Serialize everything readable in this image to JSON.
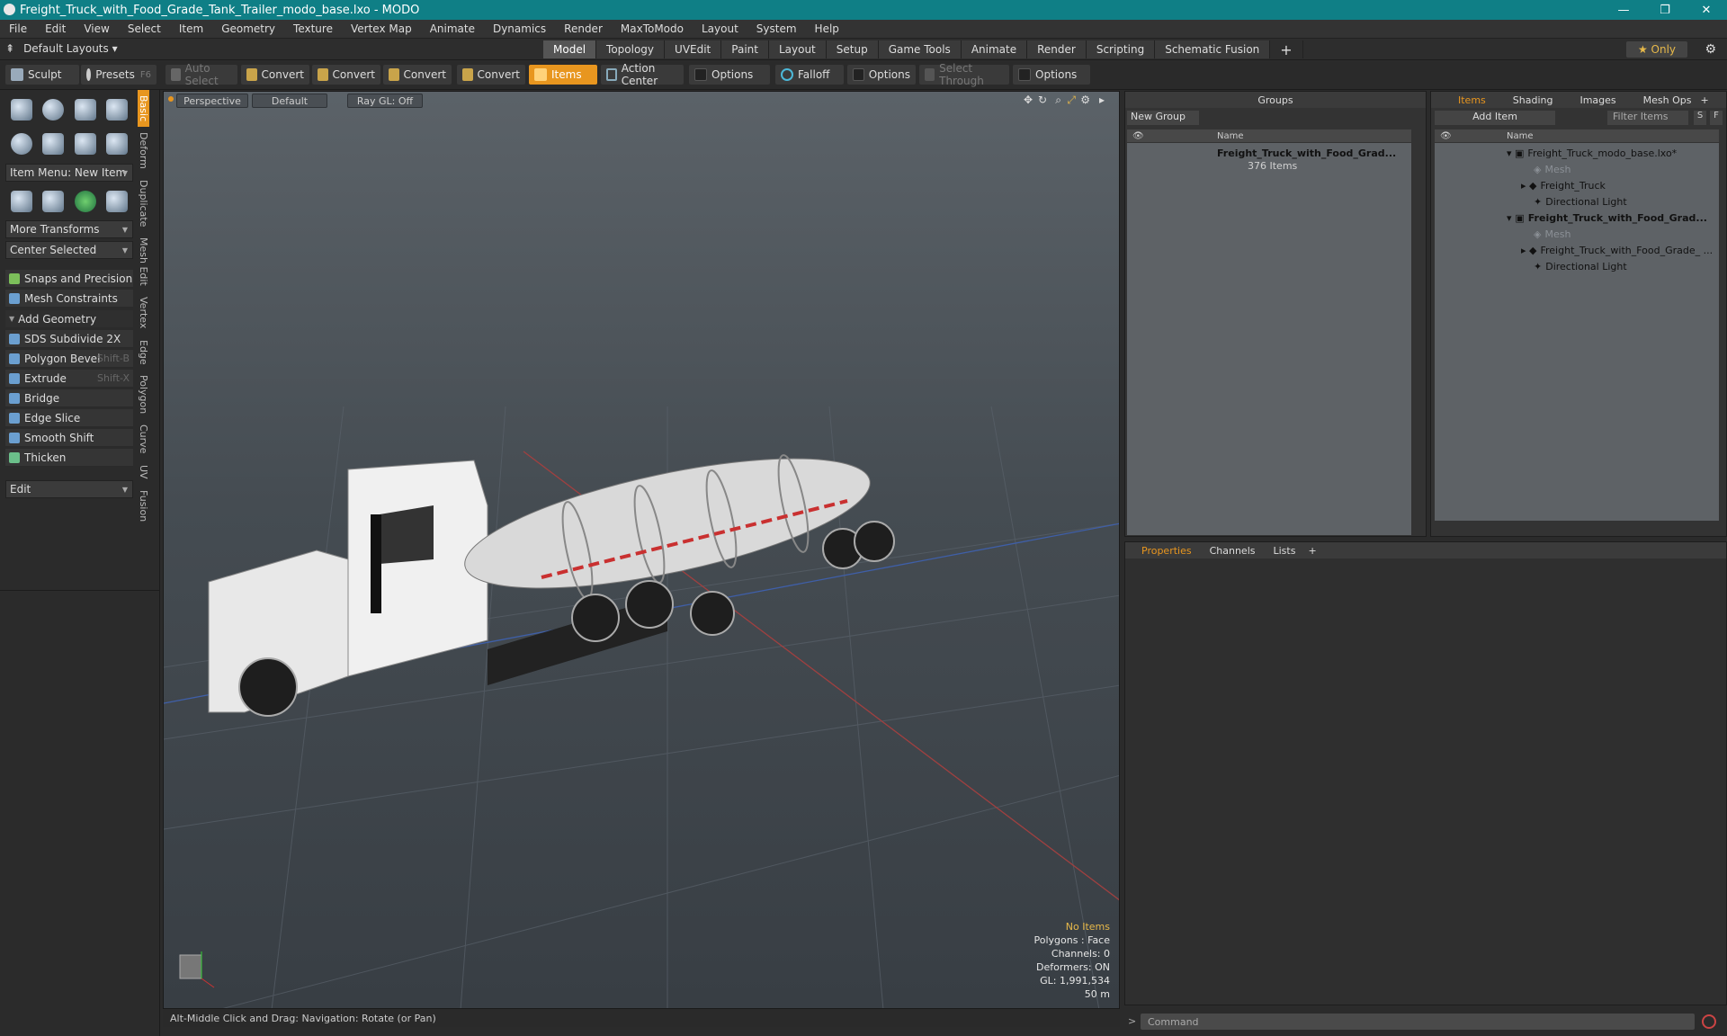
{
  "window": {
    "title": "Freight_Truck_with_Food_Grade_Tank_Trailer_modo_base.lxo - MODO"
  },
  "menu": [
    "File",
    "Edit",
    "View",
    "Select",
    "Item",
    "Geometry",
    "Texture",
    "Vertex Map",
    "Animate",
    "Dynamics",
    "Render",
    "MaxToModo",
    "Layout",
    "System",
    "Help"
  ],
  "layout": {
    "label": "Default Layouts ▾",
    "only": "★ Only"
  },
  "tabs": [
    "Model",
    "Topology",
    "UVEdit",
    "Paint",
    "Layout",
    "Setup",
    "Game Tools",
    "Animate",
    "Render",
    "Scripting",
    "Schematic Fusion",
    "+"
  ],
  "toolbar": {
    "sculpt": "Sculpt",
    "presets": "Presets",
    "presets_key": "F6",
    "auto_select": "Auto Select",
    "convert1": "Convert",
    "convert2": "Convert",
    "convert3": "Convert",
    "convert4": "Convert",
    "items": "Items",
    "action_center": "Action Center",
    "options1": "Options",
    "falloff": "Falloff",
    "options2": "Options",
    "select_through": "Select Through",
    "options3": "Options"
  },
  "left": {
    "vtabs": [
      "Basic",
      "Deform",
      "Duplicate",
      "Mesh Edit",
      "Vertex",
      "Edge",
      "Polygon",
      "Curve",
      "UV",
      "Fusion"
    ],
    "item_menu": "Item Menu: New Item",
    "more_transforms": "More Transforms",
    "center_selected": "Center Selected",
    "snaps": "Snaps and Precision",
    "mesh_constraints": "Mesh Constraints",
    "add_geometry": "Add Geometry",
    "tools": [
      {
        "label": "SDS Subdivide 2X",
        "key": ""
      },
      {
        "label": "Polygon Bevel",
        "key": "Shift-B"
      },
      {
        "label": "Extrude",
        "key": "Shift-X"
      },
      {
        "label": "Bridge",
        "key": ""
      },
      {
        "label": "Edge Slice",
        "key": ""
      },
      {
        "label": "Smooth Shift",
        "key": ""
      },
      {
        "label": "Thicken",
        "key": ""
      }
    ],
    "edit": "Edit"
  },
  "viewport": {
    "view": "Perspective",
    "shading": "Default",
    "raygl": "Ray GL: Off",
    "stats": {
      "selection": "No Items",
      "polygons": "Polygons : Face",
      "channels": "Channels: 0",
      "deformers": "Deformers: ON",
      "gl": "GL: 1,991,534",
      "scale": "50 m"
    }
  },
  "status": {
    "hint": "Alt-Middle Click and Drag:   Navigation: Rotate (or Pan)"
  },
  "groups": {
    "title": "Groups",
    "new_group": "New Group",
    "name_col": "Name",
    "entry": "Freight_Truck_with_Food_Grad...",
    "count": "376 Items"
  },
  "items_panel": {
    "tabs": [
      "Items",
      "Shading",
      "Images",
      "Mesh Ops",
      "+"
    ],
    "add_item": "Add Item",
    "filter": "Filter Items",
    "s": "S",
    "f": "F",
    "name_col": "Name",
    "rows": [
      {
        "label": "Freight_Truck_modo_base.lxo*",
        "style": "",
        "indent": 0
      },
      {
        "label": "Mesh",
        "style": "dim",
        "indent": 1
      },
      {
        "label": "Freight_Truck",
        "style": "",
        "indent": 1
      },
      {
        "label": "Directional Light",
        "style": "",
        "indent": 1
      },
      {
        "label": "Freight_Truck_with_Food_Grad...",
        "style": "bold",
        "indent": 0
      },
      {
        "label": "Mesh",
        "style": "dim",
        "indent": 1
      },
      {
        "label": "Freight_Truck_with_Food_Grade_ ...",
        "style": "",
        "indent": 1
      },
      {
        "label": "Directional Light",
        "style": "",
        "indent": 1
      }
    ]
  },
  "properties": {
    "tabs": [
      "Properties",
      "Channels",
      "Lists",
      "+"
    ]
  },
  "command": {
    "placeholder": "Command"
  }
}
